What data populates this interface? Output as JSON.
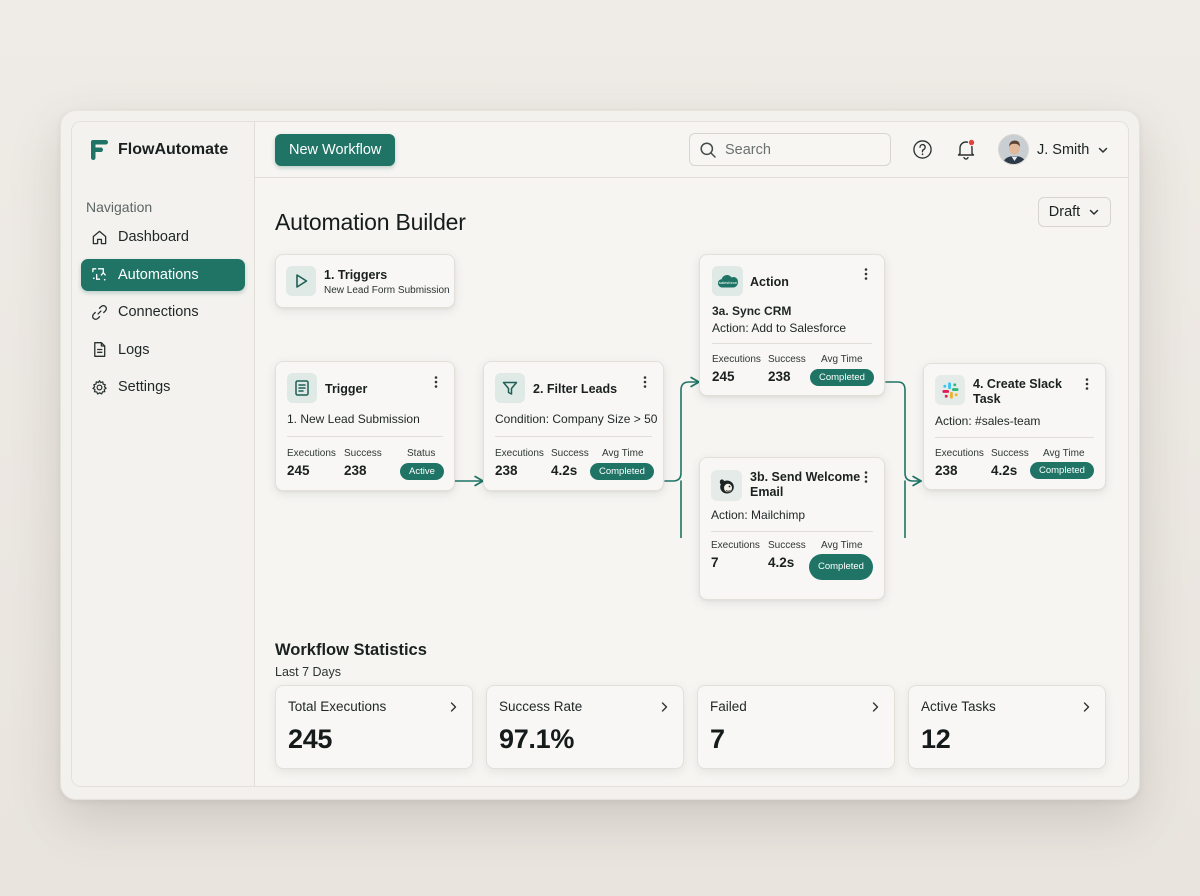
{
  "app": {
    "brand_name": "FlowAutomate"
  },
  "colors": {
    "accent": "#1f7466",
    "notification_dot": "#e0443b"
  },
  "sidebar": {
    "heading": "Navigation",
    "items": [
      {
        "label": "Dashboard",
        "icon": "home-icon",
        "active": false
      },
      {
        "label": "Automations",
        "icon": "automation-icon",
        "active": true
      },
      {
        "label": "Connections",
        "icon": "link-icon",
        "active": false
      },
      {
        "label": "Logs",
        "icon": "document-icon",
        "active": false
      },
      {
        "label": "Settings",
        "icon": "gear-icon",
        "active": false
      }
    ]
  },
  "topbar": {
    "new_workflow_label": "New Workflow",
    "search_placeholder": "Search",
    "user_name": "J. Smith"
  },
  "page": {
    "title": "Automation Builder",
    "status_select": "Draft"
  },
  "flow": {
    "triggers": {
      "title": "1. Triggers",
      "subtitle": "New Lead Form Submission",
      "icon": "play-icon"
    },
    "trigger": {
      "title": "Trigger",
      "line": "1. New Lead Submission",
      "icon": "form-icon",
      "labels": [
        "Executions",
        "Success",
        "Status"
      ],
      "values": [
        "245",
        "238"
      ],
      "badge": "Active"
    },
    "filter": {
      "title": "2. Filter Leads",
      "line": "Condition: Company Size > 50",
      "icon": "filter-icon",
      "labels": [
        "Executions",
        "Success",
        "Avg Time"
      ],
      "values": [
        "238",
        "4.2s"
      ],
      "badge": "Completed"
    },
    "sync_crm": {
      "header": "Action",
      "title": "3a. Sync CRM",
      "line": "Action: Add to Salesforce",
      "icon": "salesforce-icon",
      "labels": [
        "Executions",
        "Success",
        "Avg Time"
      ],
      "values": [
        "245",
        "238"
      ],
      "badge": "Completed"
    },
    "welcome_email": {
      "title_1": "3b. Send Welcome",
      "title_2": "Email",
      "line": "Action: Mailchimp",
      "icon": "mailchimp-icon",
      "labels": [
        "Executions",
        "Success",
        "Avg Time"
      ],
      "values": [
        "7",
        "4.2s"
      ],
      "badge": "Completed"
    },
    "slack_task": {
      "title_1": "4. Create Slack",
      "title_2": "Task",
      "line": "Action: #sales-team",
      "icon": "slack-icon",
      "labels": [
        "Executions",
        "Success",
        "Avg Time"
      ],
      "values": [
        "238",
        "4.2s"
      ],
      "badge": "Completed"
    }
  },
  "stats": {
    "title": "Workflow Statistics",
    "subtitle": "Last 7 Days",
    "cards": [
      {
        "label": "Total Executions",
        "value": "245"
      },
      {
        "label": "Success Rate",
        "value": "97.1%"
      },
      {
        "label": "Failed",
        "value": "7"
      },
      {
        "label": "Active Tasks",
        "value": "12"
      }
    ]
  }
}
